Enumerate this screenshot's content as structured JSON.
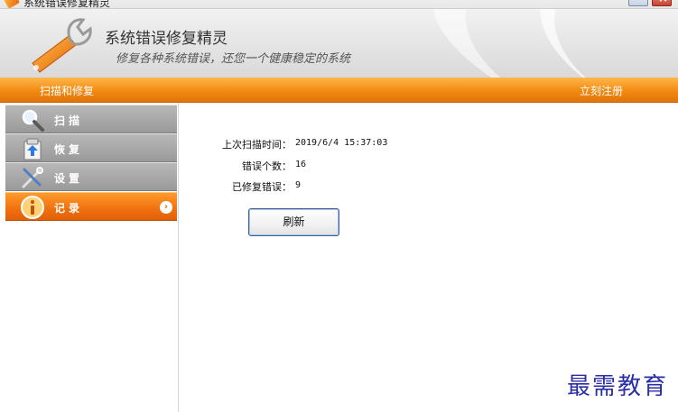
{
  "window": {
    "title": "系统错误修复精灵"
  },
  "banner": {
    "app_name": "系统错误修复精灵",
    "slogan": "修复各种系统错误，还您一个健康稳定的系统"
  },
  "menubar": {
    "left_label": "扫描和修复",
    "register_label": "立刻注册"
  },
  "sidebar": {
    "items": [
      {
        "label": "扫描",
        "icon": "magnifier-icon",
        "active": false
      },
      {
        "label": "恢复",
        "icon": "restore-icon",
        "active": false
      },
      {
        "label": "设置",
        "icon": "tools-icon",
        "active": false
      },
      {
        "label": "记录",
        "icon": "info-icon",
        "active": true
      }
    ]
  },
  "main": {
    "last_scan_label": "上次扫描时间：",
    "last_scan_value": "2019/6/4 15:37:03",
    "error_count_label": "错误个数：",
    "error_count_value": "16",
    "fixed_count_label": "已修复错误：",
    "fixed_count_value": "9",
    "refresh_label": "刷新"
  },
  "watermark": "最需教育",
  "colors": {
    "accent": "#f28a12",
    "sidebar_item": "#a8a8a8",
    "active_item": "#f0700f"
  }
}
